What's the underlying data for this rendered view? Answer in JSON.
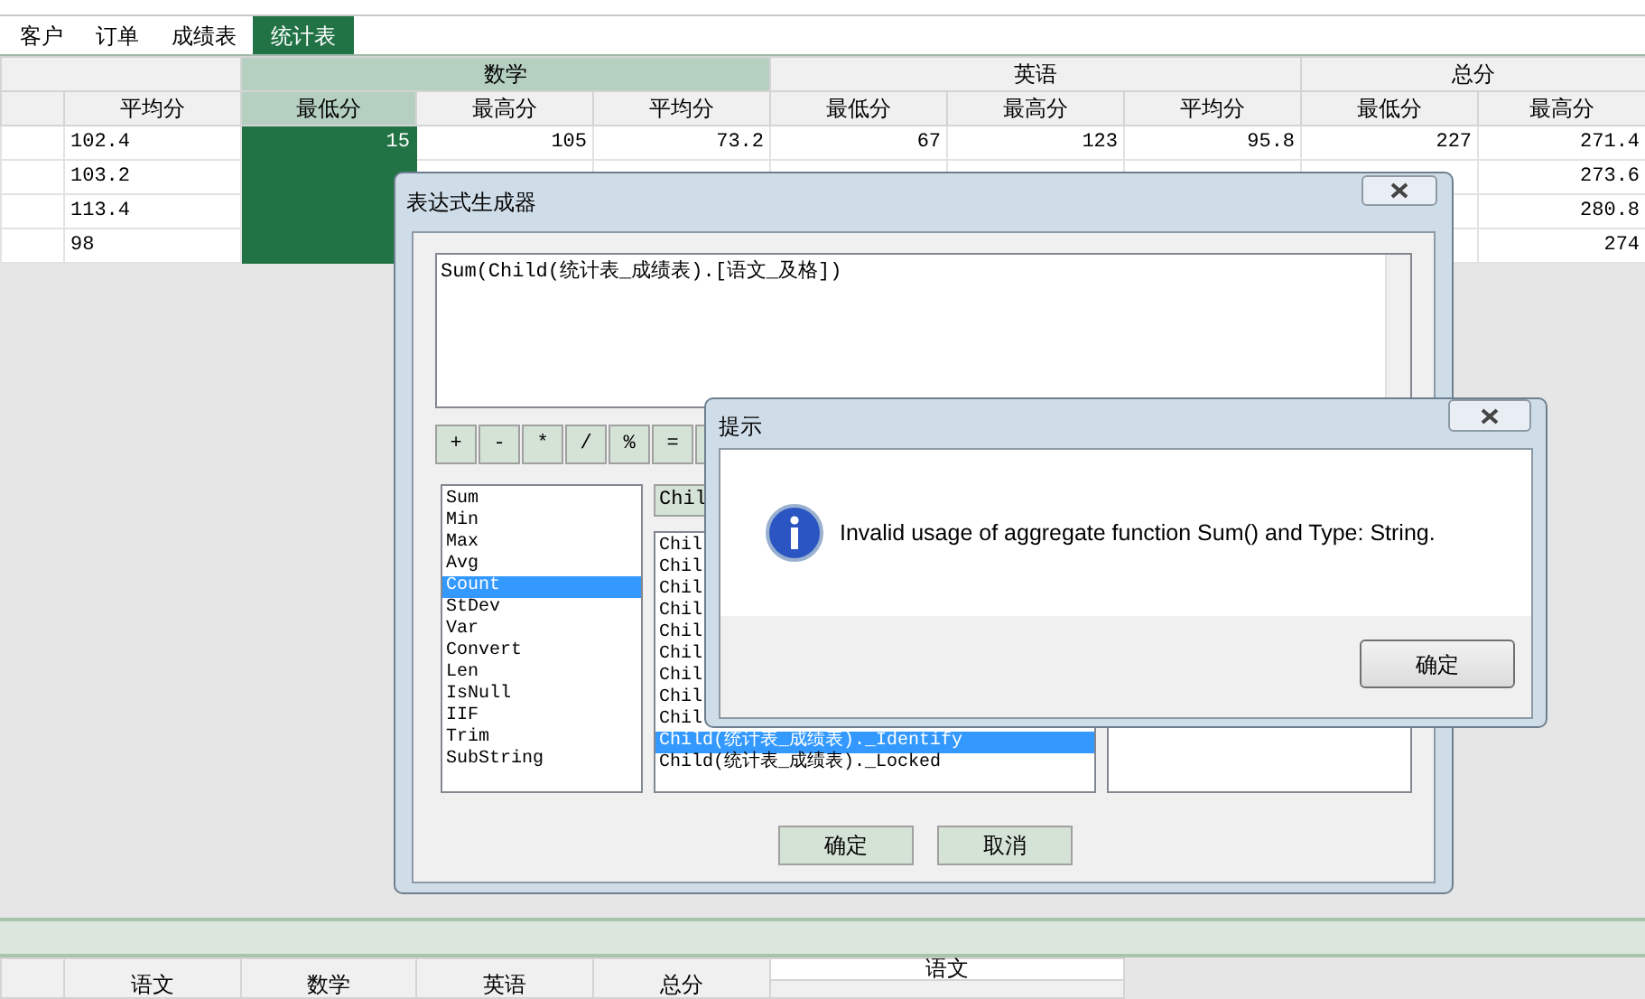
{
  "tabs": [
    {
      "label": "客户",
      "selected": false
    },
    {
      "label": "订单",
      "selected": false
    },
    {
      "label": "成绩表",
      "selected": false
    },
    {
      "label": "统计表",
      "selected": true
    }
  ],
  "table": {
    "groups": [
      {
        "label": "数学",
        "selected": true
      },
      {
        "label": "英语",
        "selected": false
      },
      {
        "label": "总分",
        "selected": false
      }
    ],
    "columns": [
      {
        "label": "平均分",
        "selected": false
      },
      {
        "label": "最低分",
        "selected": true
      },
      {
        "label": "最高分",
        "selected": false
      },
      {
        "label": "平均分",
        "selected": false
      },
      {
        "label": "最低分",
        "selected": false
      },
      {
        "label": "最高分",
        "selected": false
      },
      {
        "label": "平均分",
        "selected": false
      },
      {
        "label": "最低分",
        "selected": false
      },
      {
        "label": "最高分",
        "selected": false
      }
    ],
    "rows": [
      [
        "102.4",
        "15",
        "105",
        "73.2",
        "67",
        "123",
        "95.8",
        "227",
        "271.4"
      ],
      [
        "103.2",
        null,
        null,
        null,
        null,
        null,
        null,
        null,
        "273.6"
      ],
      [
        "113.4",
        null,
        null,
        null,
        null,
        null,
        null,
        null,
        "280.8"
      ],
      [
        "98",
        null,
        null,
        null,
        null,
        null,
        null,
        null,
        "274"
      ]
    ]
  },
  "bottom_table": {
    "columns": [
      "语文",
      "数学",
      "英语",
      "总分"
    ],
    "group": "语文"
  },
  "expression_builder": {
    "title": "表达式生成器",
    "expression": "Sum(Child(统计表_成绩表).[语文_及格])",
    "operators": [
      "+",
      "-",
      "*",
      "/",
      "%",
      "="
    ],
    "functions": [
      {
        "label": "Sum",
        "selected": false
      },
      {
        "label": "Min",
        "selected": false
      },
      {
        "label": "Max",
        "selected": false
      },
      {
        "label": "Avg",
        "selected": false
      },
      {
        "label": "Count",
        "selected": true
      },
      {
        "label": "StDev",
        "selected": false
      },
      {
        "label": "Var",
        "selected": false
      },
      {
        "label": "Convert",
        "selected": false
      },
      {
        "label": "Len",
        "selected": false
      },
      {
        "label": "IsNull",
        "selected": false
      },
      {
        "label": "IIF",
        "selected": false
      },
      {
        "label": "Trim",
        "selected": false
      },
      {
        "label": "SubString",
        "selected": false
      }
    ],
    "field_header": "Chil",
    "fields": [
      {
        "label": "Chil",
        "selected": false
      },
      {
        "label": "Chil",
        "selected": false
      },
      {
        "label": "Chil",
        "selected": false
      },
      {
        "label": "Chil",
        "selected": false
      },
      {
        "label": "Chil",
        "selected": false
      },
      {
        "label": "Chil",
        "selected": false
      },
      {
        "label": "Chil",
        "selected": false
      },
      {
        "label": "Chil",
        "selected": false
      },
      {
        "label": "Chil",
        "selected": false
      },
      {
        "label": "Child(统计表_成绩表)._Identify",
        "selected": true
      },
      {
        "label": "Child(统计表_成绩表)._Locked",
        "selected": false
      }
    ],
    "buttons": [
      "确定",
      "取消"
    ]
  },
  "message_box": {
    "title": "提示",
    "message": "Invalid usage of aggregate function Sum() and Type: String.",
    "button": "确定"
  }
}
